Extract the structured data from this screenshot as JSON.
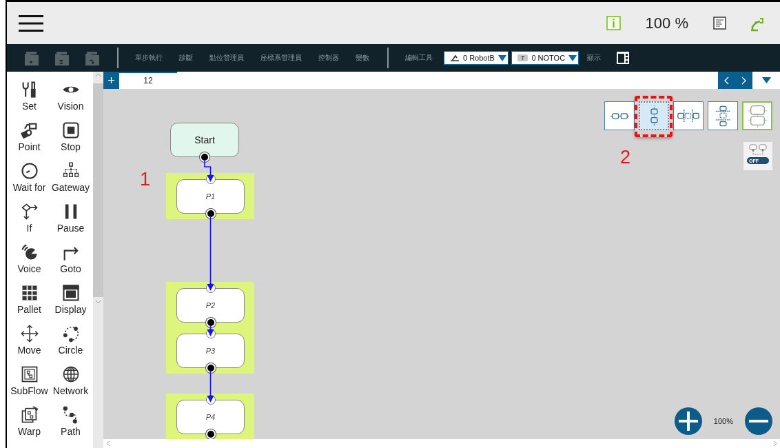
{
  "header": {
    "zoom": "100 %"
  },
  "toolbar": {
    "menu_items": [
      "單步執行",
      "診斷",
      "點位管理員",
      "座標系管理員",
      "控制器",
      "變數"
    ],
    "edit_label": "編輯工具",
    "base_dropdown": {
      "value": "0 RobotB"
    },
    "tool_dropdown": {
      "badge": "T",
      "value": "0 NOTOC"
    },
    "display_label": "顯示"
  },
  "palette": [
    {
      "label": "Set"
    },
    {
      "label": "Vision"
    },
    {
      "label": "Point"
    },
    {
      "label": "Stop"
    },
    {
      "label": "Wait for"
    },
    {
      "label": "Gateway"
    },
    {
      "label": "If"
    },
    {
      "label": "Pause"
    },
    {
      "label": "Voice"
    },
    {
      "label": "Goto"
    },
    {
      "label": "Pallet"
    },
    {
      "label": "Display"
    },
    {
      "label": "Move"
    },
    {
      "label": "Circle"
    },
    {
      "label": "SubFlow"
    },
    {
      "label": "Network"
    },
    {
      "label": "Warp"
    },
    {
      "label": "Path"
    }
  ],
  "tabs": [
    {
      "label": "12",
      "selected": true
    }
  ],
  "canvas": {
    "nodes": [
      {
        "kind": "start",
        "label": "Start",
        "highlighted": false
      },
      {
        "kind": "point",
        "label": "P1",
        "highlighted": true
      },
      {
        "kind": "point",
        "label": "P2",
        "highlighted": true
      },
      {
        "kind": "point",
        "label": "P3",
        "highlighted": true
      },
      {
        "kind": "point",
        "label": "P4",
        "highlighted": true
      }
    ],
    "layout_buttons": [
      {
        "selected": false,
        "highlighted": false
      },
      {
        "selected": true,
        "highlighted": false
      },
      {
        "selected": false,
        "highlighted": false
      },
      {
        "selected": false,
        "highlighted": false
      },
      {
        "selected": false,
        "highlighted": true
      }
    ],
    "toggle": {
      "label": "OFF",
      "on": false
    },
    "annotations": [
      {
        "label": "1"
      },
      {
        "label": "2"
      }
    ],
    "zoom": "100%"
  }
}
